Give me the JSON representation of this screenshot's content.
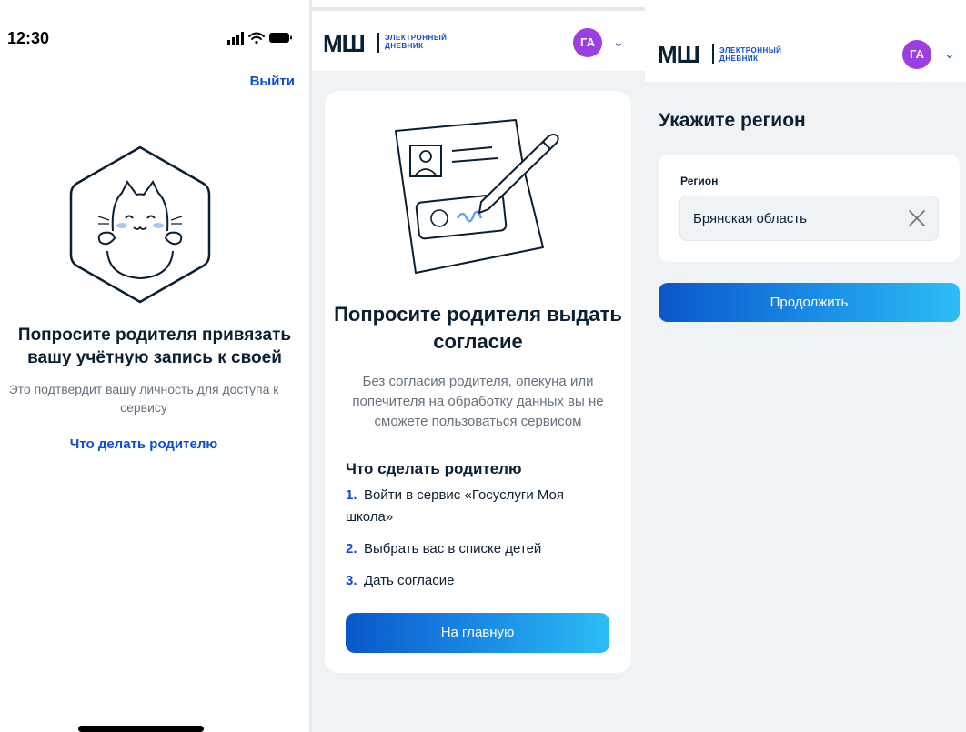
{
  "screen1": {
    "status_time": "12:30",
    "logout_label": "Выйти",
    "title": "Попросите родителя привязать вашу учётную запись к своей",
    "subtitle": "Это подтвердит вашу личность для доступа к сервису",
    "link_label": "Что делать родителю"
  },
  "screen2": {
    "logo_mark": "МШ",
    "logo_line1": "ЭЛЕКТРОННЫЙ",
    "logo_line2": "ДНЕВНИК",
    "avatar_initials": "ГА",
    "title": "Попросите родителя выдать согласие",
    "body": "Без согласия родителя, опекуна или попечителя на обработку данных вы не сможете пользоваться сервисом",
    "steps_title": "Что сделать родителю",
    "steps": [
      {
        "num": "1.",
        "text": "Войти в сервис «Госуслуги Моя школа»"
      },
      {
        "num": "2.",
        "text": "Выбрать вас в списке детей"
      },
      {
        "num": "3.",
        "text": "Дать согласие"
      }
    ],
    "button_label": "На главную"
  },
  "screen3": {
    "logo_mark": "МШ",
    "logo_line1": "ЭЛЕКТРОННЫЙ",
    "logo_line2": "ДНЕВНИК",
    "avatar_initials": "ГА",
    "title": "Укажите регион",
    "field_label": "Регион",
    "field_value": "Брянская область",
    "button_label": "Продолжить"
  },
  "colors": {
    "accent": "#0d4cd3",
    "avatar": "#9b3fe0",
    "background": "#f0f3f6",
    "text": "#0b1f33",
    "muted": "#66727f"
  },
  "icons": [
    "signal-icon",
    "wifi-icon",
    "battery-icon",
    "cat-illustration",
    "document-illustration",
    "chevron-down-icon",
    "close-icon"
  ]
}
